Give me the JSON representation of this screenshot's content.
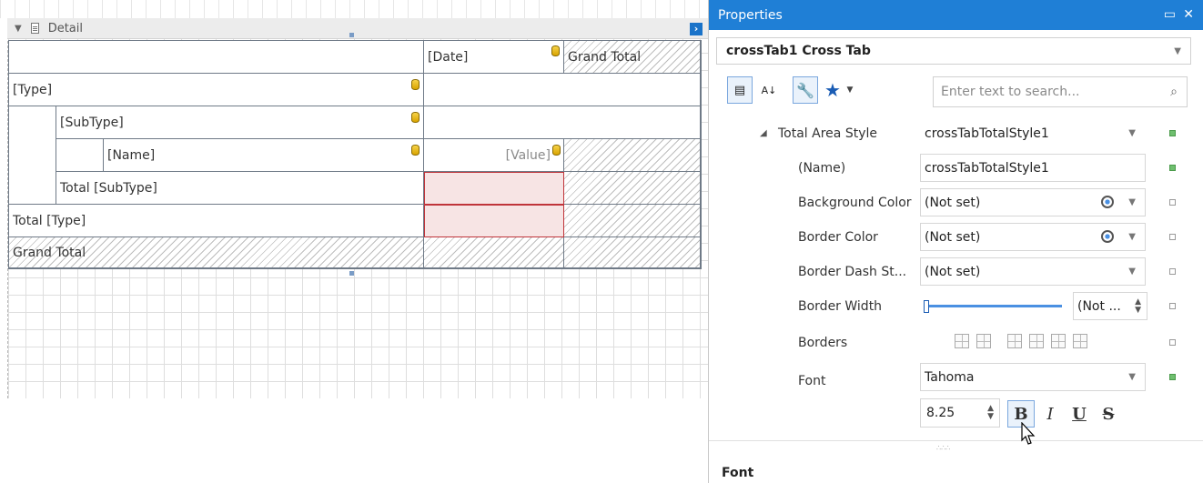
{
  "designer": {
    "band_label": "Detail",
    "crosstab": {
      "date_header": "[Date]",
      "grand_total_col": "Grand Total",
      "type_row": "[Type]",
      "subtype_row": "[SubType]",
      "name_row": "[Name]",
      "value_cell": "[Value]",
      "total_subtype": "Total [SubType]",
      "total_type": "Total [Type]",
      "grand_total_row": "Grand Total"
    }
  },
  "properties": {
    "title": "Properties",
    "selected_object": "crossTab1  Cross Tab",
    "search_placeholder": "Enter text to search...",
    "rows": {
      "total_area_style": {
        "label": "Total Area Style",
        "value": "crossTabTotalStyle1"
      },
      "name": {
        "label": "(Name)",
        "value": "crossTabTotalStyle1"
      },
      "background_color": {
        "label": "Background Color",
        "value": "(Not set)"
      },
      "border_color": {
        "label": "Border Color",
        "value": "(Not set)"
      },
      "border_dash_style": {
        "label": "Border Dash St...",
        "value": "(Not set)"
      },
      "border_width": {
        "label": "Border Width",
        "value": "(Not ..."
      },
      "borders": {
        "label": "Borders"
      },
      "font": {
        "label": "Font",
        "value": "Tahoma"
      }
    },
    "font_size": "8.25",
    "font_buttons": {
      "bold": "B",
      "italic": "I",
      "underline": "U",
      "strike": "S"
    },
    "description_title": "Font"
  },
  "colors": {
    "accent": "#1f7fd6",
    "selection_border": "#c0343a",
    "selection_fill": "#f7e4e4"
  }
}
